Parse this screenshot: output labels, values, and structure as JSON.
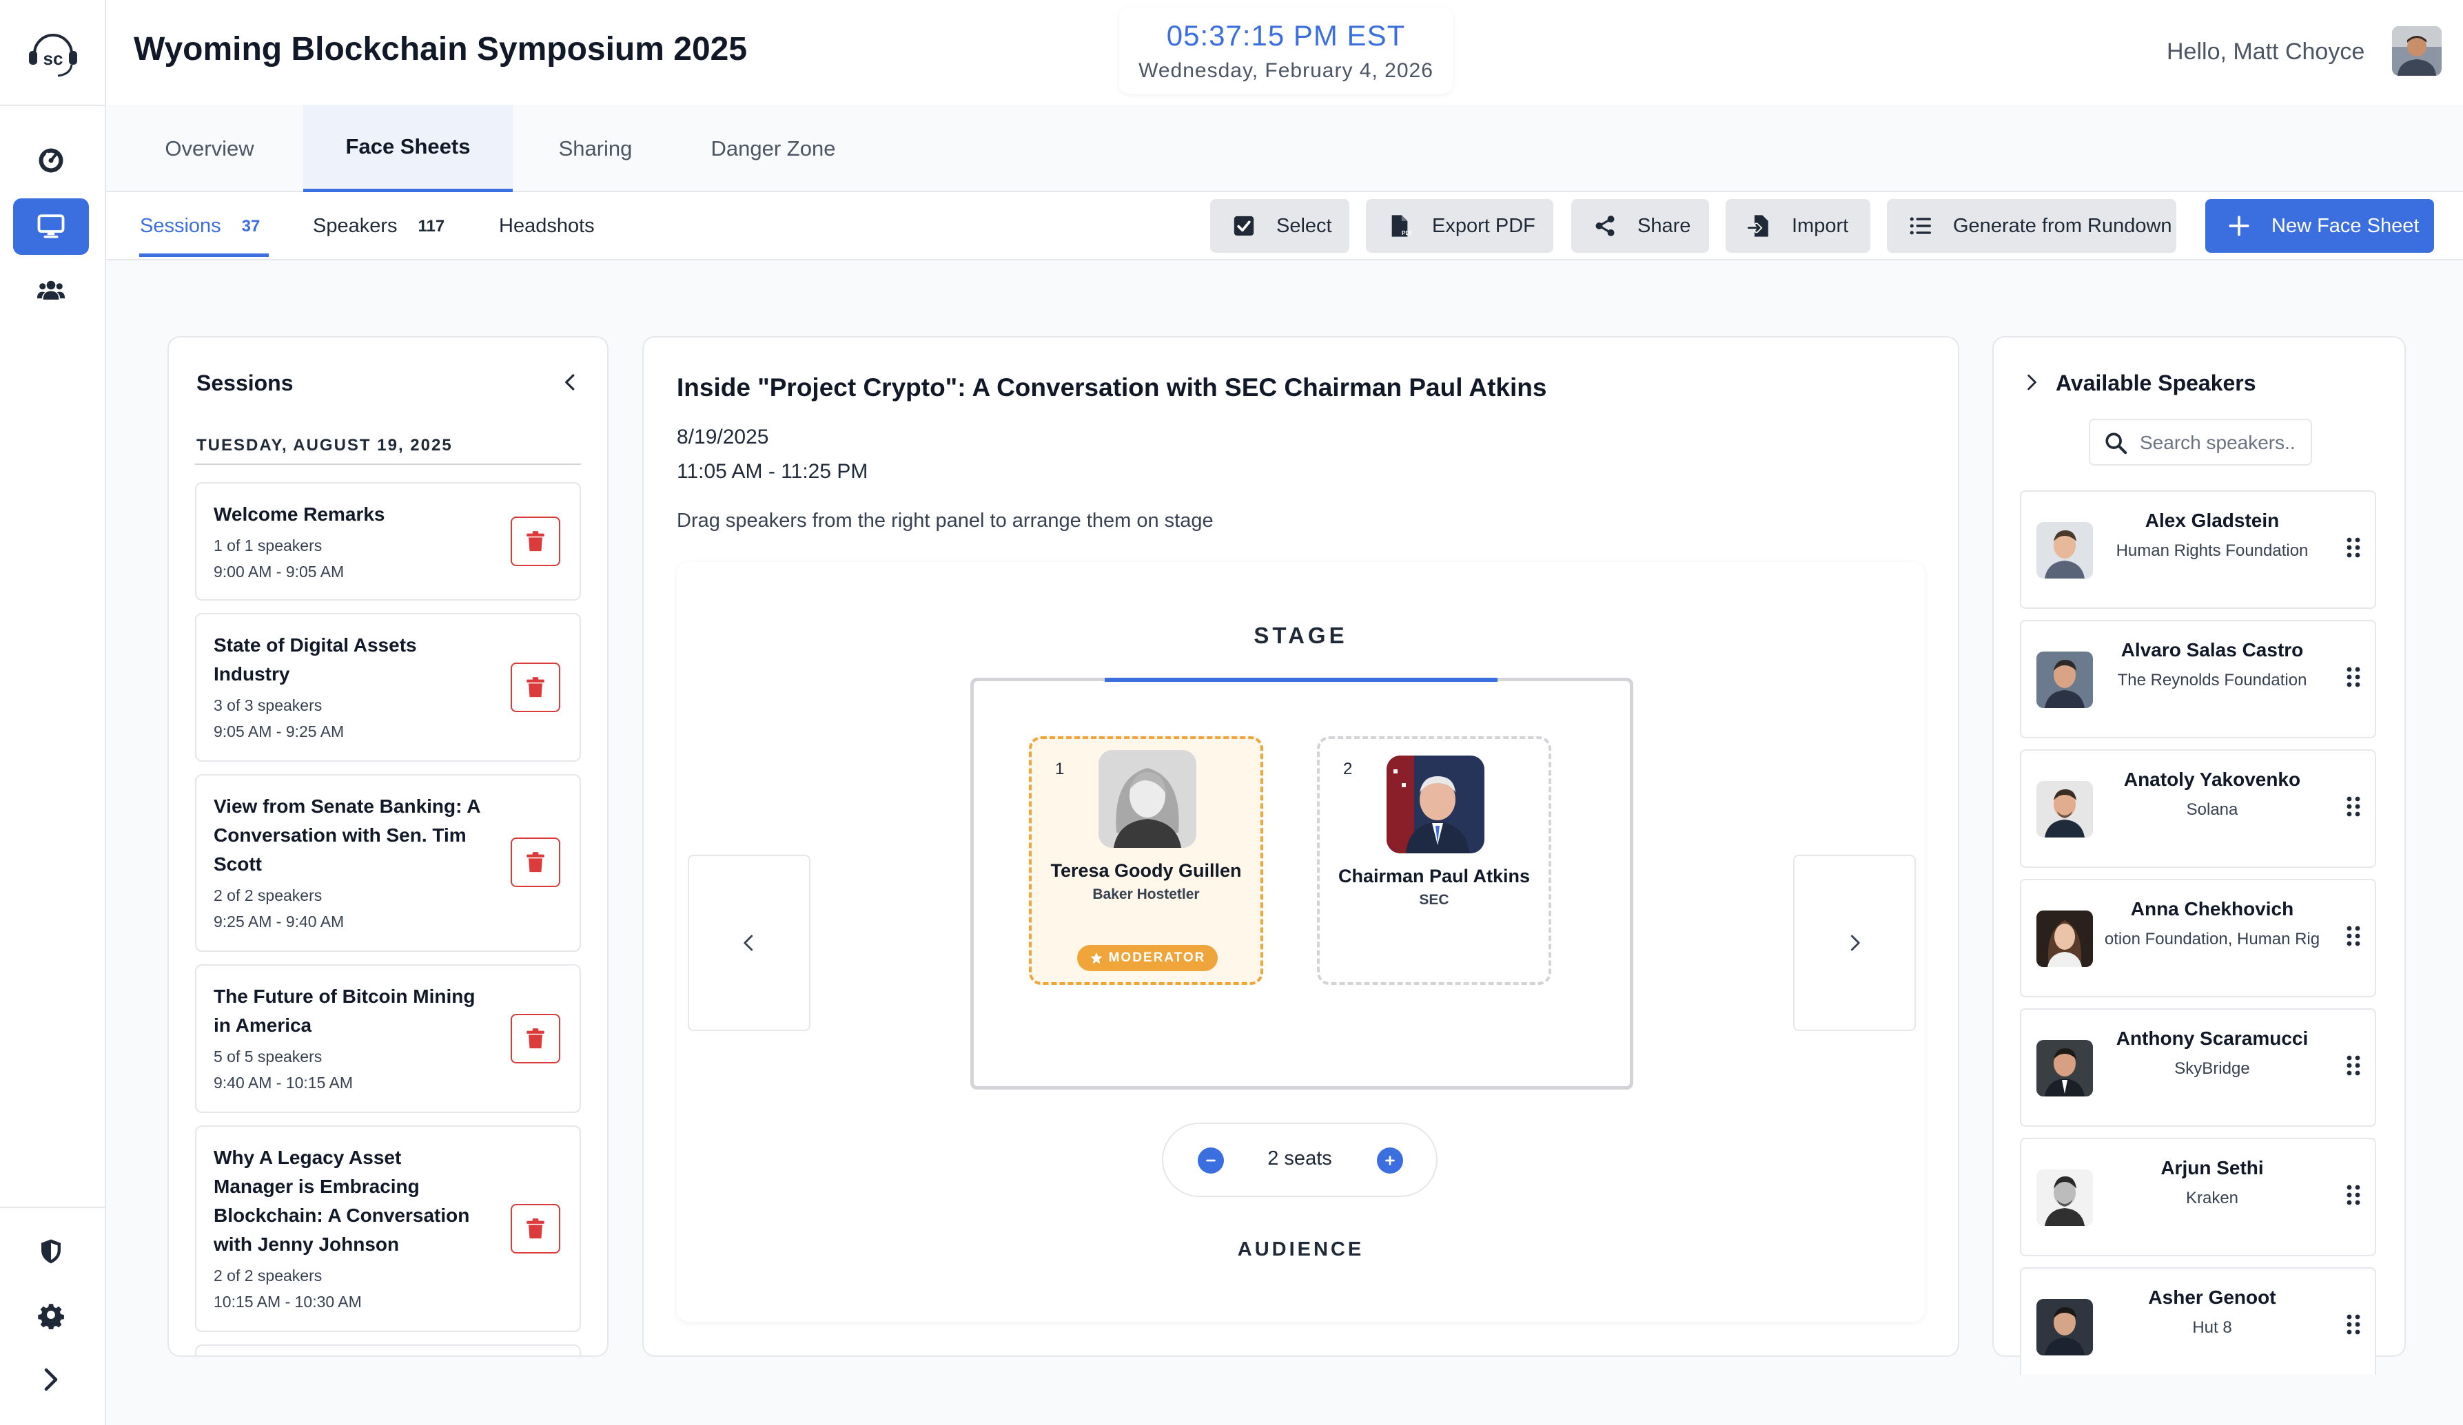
{
  "header": {
    "title": "Wyoming Blockchain Symposium 2025",
    "clock_time": "05:37:15 PM EST",
    "clock_date": "Wednesday, February 4, 2026",
    "greeting": "Hello, Matt Choyce"
  },
  "sidebar": {
    "logo_text": "sc",
    "items": [
      {
        "icon": "dashboard-icon",
        "active": false
      },
      {
        "icon": "monitor-icon",
        "active": true
      },
      {
        "icon": "users-icon",
        "active": false
      }
    ],
    "bottom_items": [
      {
        "icon": "shield-icon"
      },
      {
        "icon": "gear-icon"
      },
      {
        "icon": "chevron-right-icon"
      }
    ]
  },
  "tabs": [
    {
      "label": "Overview",
      "active": false
    },
    {
      "label": "Face Sheets",
      "active": true
    },
    {
      "label": "Sharing",
      "active": false
    },
    {
      "label": "Danger Zone",
      "active": false
    }
  ],
  "subtabs": [
    {
      "label": "Sessions",
      "count": "37",
      "active": true
    },
    {
      "label": "Speakers",
      "count": "117",
      "active": false
    },
    {
      "label": "Headshots",
      "count": "",
      "active": false
    }
  ],
  "toolbar": {
    "select": "Select",
    "export_pdf": "Export PDF",
    "share": "Share",
    "import": "Import",
    "generate": "Generate from Rundown",
    "new_face_sheet": "New Face Sheet"
  },
  "sessions_panel": {
    "title": "Sessions",
    "day": "TUESDAY, AUGUST 19, 2025",
    "sessions": [
      {
        "title": "Welcome Remarks",
        "speakers": "1 of 1 speakers",
        "time": "9:00 AM - 9:05 AM"
      },
      {
        "title": "State of Digital Assets Industry",
        "speakers": "3 of 3 speakers",
        "time": "9:05 AM - 9:25 AM"
      },
      {
        "title": "View from Senate Banking: A Conversation with Sen. Tim Scott",
        "speakers": "2 of 2 speakers",
        "time": "9:25 AM - 9:40 AM"
      },
      {
        "title": "The Future of Bitcoin Mining in America",
        "speakers": "5 of 5 speakers",
        "time": "9:40 AM - 10:15 AM"
      },
      {
        "title": "Why A Legacy Asset Manager is Embracing Blockchain: A Conversation with Jenny Johnson",
        "speakers": "2 of 2 speakers",
        "time": "10:15 AM - 10:30 AM"
      }
    ]
  },
  "session_detail": {
    "title": "Inside \"Project Crypto\": A Conversation with SEC Chairman Paul Atkins",
    "date": "8/19/2025",
    "time": "11:05 AM - 11:25 PM",
    "hint": "Drag speakers from the right panel to arrange them on stage",
    "stage_label": "STAGE",
    "audience_label": "AUDIENCE",
    "seats_text": "2 seats",
    "seats": [
      {
        "number": "1",
        "name": "Teresa Goody Guillen",
        "org": "Baker Hostetler",
        "badge": "MODERATOR"
      },
      {
        "number": "2",
        "name": "Chairman Paul Atkins",
        "org": "SEC",
        "badge": ""
      }
    ]
  },
  "speakers_panel": {
    "title": "Available Speakers",
    "search_placeholder": "Search speakers..",
    "speakers": [
      {
        "name": "Alex Gladstein",
        "org": "Human Rights Foundation"
      },
      {
        "name": "Alvaro Salas Castro",
        "org": "The Reynolds Foundation"
      },
      {
        "name": "Anatoly Yakovenko",
        "org": "Solana"
      },
      {
        "name": "Anna Chekhovich",
        "org": "otion Foundation, Human Rig"
      },
      {
        "name": "Anthony Scaramucci",
        "org": "SkyBridge"
      },
      {
        "name": "Arjun Sethi",
        "org": "Kraken"
      },
      {
        "name": "Asher Genoot",
        "org": "Hut 8"
      }
    ]
  },
  "colors": {
    "accent": "#3b6fe0",
    "danger": "#dc3b3b",
    "moderator": "#f0a53a"
  }
}
